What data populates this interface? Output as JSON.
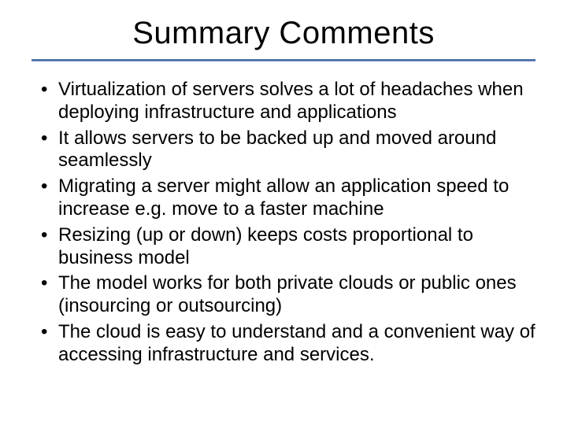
{
  "slide": {
    "title": "Summary Comments",
    "bullets": [
      "Virtualization of servers solves a lot of headaches when deploying infrastructure and applications",
      "It allows servers to be backed up and moved around seamlessly",
      "Migrating a server might allow an application speed to increase e.g. move to a faster machine",
      "Resizing (up or down) keeps costs proportional to business model",
      "The model works for both private clouds or public ones (insourcing or outsourcing)",
      "The cloud is easy to understand and a convenient way of accessing infrastructure and services."
    ]
  }
}
